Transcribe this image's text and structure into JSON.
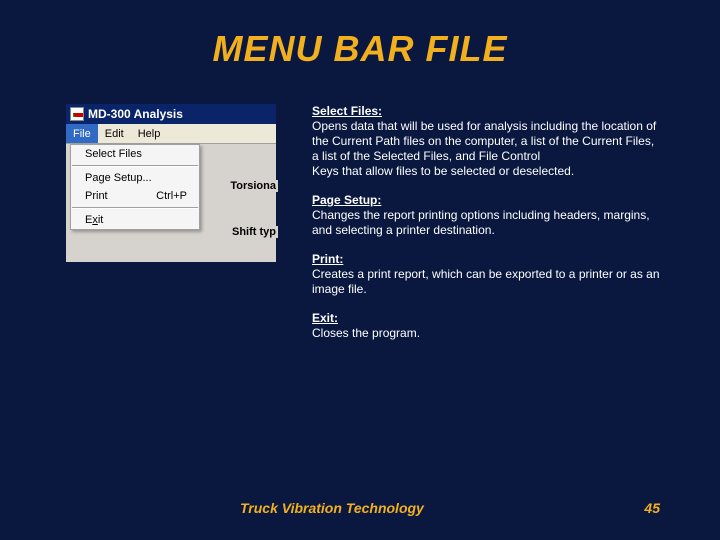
{
  "title": "MENU BAR FILE",
  "window": {
    "title": "MD-300 Analysis",
    "menubar": [
      {
        "label": "File",
        "selected": true
      },
      {
        "label": "Edit",
        "selected": false
      },
      {
        "label": "Help",
        "selected": false
      }
    ],
    "dropdown": {
      "select_files": "Select Files",
      "page_setup": "Page Setup...",
      "print": "Print",
      "print_accel": "Ctrl+P",
      "exit_pre": "E",
      "exit_ul": "x",
      "exit_post": "it"
    },
    "bg_labels": {
      "torsional": "Torsiona",
      "shift": "Shift typ"
    }
  },
  "descriptions": {
    "select_files": {
      "head": "Select Files:",
      "body1": "Opens data that will be used for analysis including the location of the Current Path files on the computer, a list of the Current Files, a list of the Selected Files, and File Control",
      "body2": "Keys that allow files to be selected or deselected."
    },
    "page_setup": {
      "head": "Page Setup:",
      "body": "Changes the report printing options including headers, margins, and selecting a printer destination."
    },
    "print": {
      "head": "Print:",
      "body": "Creates a print report, which can be exported to a printer or as an image file."
    },
    "exit": {
      "head": "Exit:",
      "body": "Closes the program."
    }
  },
  "footer": {
    "brand": "Truck Vibration Technology",
    "page": "45"
  }
}
